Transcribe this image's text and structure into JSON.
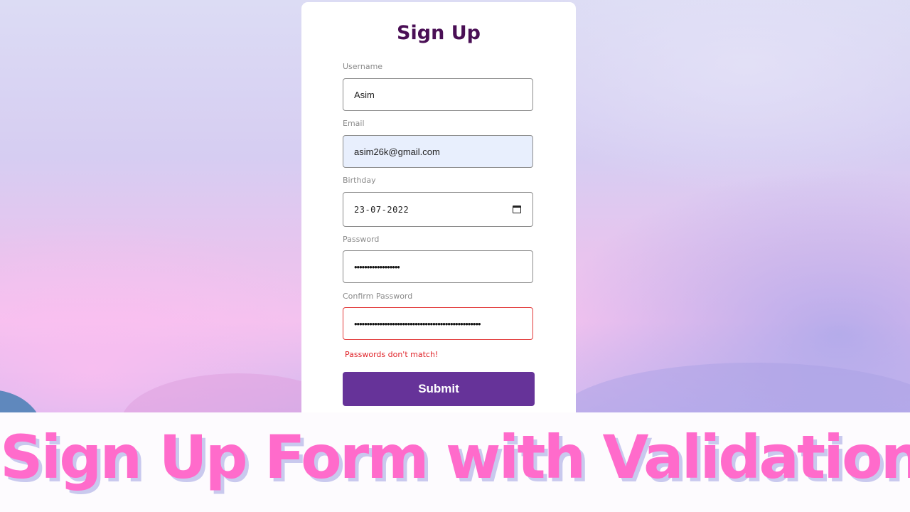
{
  "form": {
    "title": "Sign Up",
    "fields": {
      "username": {
        "label": "Username",
        "value": "Asim"
      },
      "email": {
        "label": "Email",
        "value": "asim26k@gmail.com"
      },
      "birthday": {
        "label": "Birthday",
        "value": "23-07-2022"
      },
      "password": {
        "label": "Password",
        "value": "••••••••••••••••••"
      },
      "confirm_password": {
        "label": "Confirm Password",
        "value": "••••••••••••••••••••••••••••••••••••••••••••••••••"
      }
    },
    "error_message": "Passwords don't match!",
    "submit_label": "Submit"
  },
  "banner": {
    "text": "Sign Up Form with Validation"
  },
  "colors": {
    "title": "#4a0f55",
    "submit_button": "#663399",
    "error": "#e0242a",
    "banner_text": "#ff6bcb",
    "banner_shadow": "#c9c9ee",
    "autofill_background": "#e8effd"
  },
  "icons": {
    "birthday_picker": "calendar-icon"
  }
}
